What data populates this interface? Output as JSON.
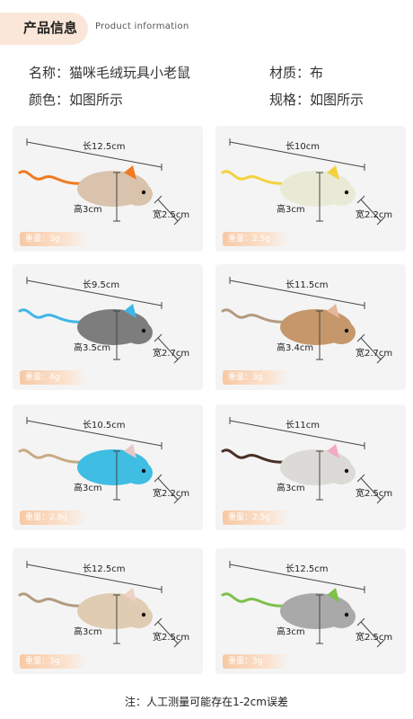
{
  "header": {
    "title_cn": "产品信息",
    "title_en": "Product information"
  },
  "info": {
    "name": "名称：猫咪毛绒玩具小老鼠",
    "material": "材质：布",
    "color": "颜色：如图所示",
    "spec": "规格：如图所示"
  },
  "weight_prefix": "重量：",
  "cards": [
    {
      "length": "长12.5cm",
      "height": "高3cm",
      "width": "宽2.5cm",
      "weight": "3g",
      "body": "#d9c3ad",
      "tail": "#f07a1e",
      "ear": "#f07a1e"
    },
    {
      "length": "长10cm",
      "height": "高3cm",
      "width": "宽2.2cm",
      "weight": "2.5g",
      "body": "#e9ead6",
      "tail": "#f3d23d",
      "ear": "#f3d23d"
    },
    {
      "length": "长9.5cm",
      "height": "高3.5cm",
      "width": "宽2.7cm",
      "weight": "4g",
      "body": "#7d7d7d",
      "tail": "#3fb6e6",
      "ear": "#3fb6e6"
    },
    {
      "length": "长11.5cm",
      "height": "高3.4cm",
      "width": "宽2.7cm",
      "weight": "3g",
      "body": "#c6976b",
      "tail": "#b39a7e",
      "ear": "#e4b89c"
    },
    {
      "length": "长10.5cm",
      "height": "高3cm",
      "width": "宽2.2cm",
      "weight": "2.8g",
      "body": "#3fbde3",
      "tail": "#c9aa83",
      "ear": "#e9c6c6"
    },
    {
      "length": "长11cm",
      "height": "高3cm",
      "width": "宽2.5cm",
      "weight": "2.5g",
      "body": "#dcdad6",
      "tail": "#4a2f25",
      "ear": "#f2a9c3"
    },
    {
      "length": "长12.5cm",
      "height": "高3cm",
      "width": "宽2.5cm",
      "weight": "3g",
      "body": "#e0ccb2",
      "tail": "#b39a7e",
      "ear": "#efd0c6"
    },
    {
      "length": "长12.5cm",
      "height": "高3cm",
      "width": "宽2.5cm",
      "weight": "3g",
      "body": "#a9a9a9",
      "tail": "#7dc04a",
      "ear": "#7dc04a"
    }
  ],
  "note": {
    "prefix": "注：",
    "text": "人工测量可能存在1-2cm误差"
  }
}
